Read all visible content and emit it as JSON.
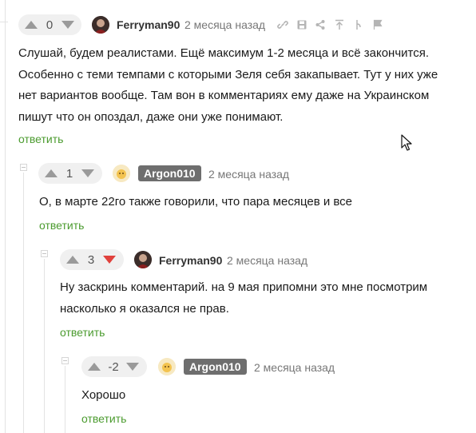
{
  "comments": [
    {
      "score": "0",
      "author": "Ferryman90",
      "date": "2 месяца назад",
      "text": "Слушай, будем реалистами. Ещё максимум 1-2 месяца и всё закончится. Особенно с теми темпами с которыми Зеля себя закапывает. Тут у них уже нет вариантов вообще. Там вон в комментариях ему даже на Украинском пишут что он опоздал, даже они уже понимают.",
      "reply": "ответить"
    },
    {
      "score": "1",
      "author": "Argon010",
      "date": "2 месяца назад",
      "text": "О, в марте 22го также говорили, что пара месяцев и все",
      "reply": "ответить"
    },
    {
      "score": "3",
      "author": "Ferryman90",
      "date": "2 месяца назад",
      "text": "Ну заскринь комментарий. на 9 мая припомни это мне посмотрим насколько я оказался не прав.",
      "reply": "ответить"
    },
    {
      "score": "-2",
      "author": "Argon010",
      "date": "2 месяца назад",
      "text": "Хорошо",
      "reply": "ответить"
    }
  ],
  "toolbar_icons": [
    "link-icon",
    "save-icon",
    "share-icon",
    "go-to-parent-icon",
    "branch-icon",
    "report-flag-icon"
  ],
  "colors": {
    "reply_link": "#4b9b2f",
    "downvoted_arrow": "#e0413c",
    "vote_bg": "#f0f0f0"
  }
}
